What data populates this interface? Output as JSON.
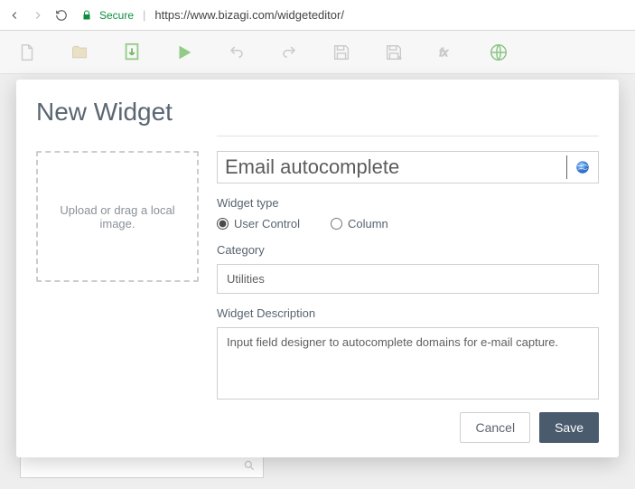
{
  "browser": {
    "secure_label": "Secure",
    "url": "https://www.bizagi.com/widgeteditor/"
  },
  "modal": {
    "title": "New Widget",
    "upload_text": "Upload or drag a local image.",
    "name_value": "Email autocomplete",
    "widget_type_label": "Widget type",
    "radios": {
      "user_control": "User Control",
      "column": "Column"
    },
    "category_label": "Category",
    "category_value": "Utilities",
    "description_label": "Widget Description",
    "description_value": "Input field designer to autocomplete domains for e-mail capture.",
    "cancel": "Cancel",
    "save": "Save"
  }
}
